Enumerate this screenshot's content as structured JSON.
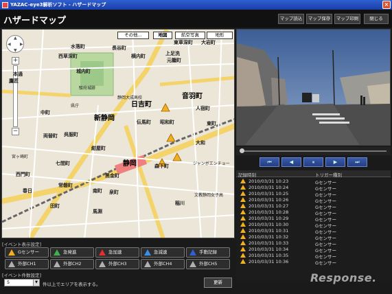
{
  "window": {
    "title": "YAZAC-eye3解析ソフト - ハザードマップ",
    "close": "×"
  },
  "header": {
    "title": "ハザードマップ",
    "buttons": [
      "マップ読込",
      "マップ保存",
      "マップ印刷",
      "閉じる"
    ]
  },
  "map": {
    "types": [
      "その他...",
      "地図",
      "航空写真",
      "地形"
    ],
    "nav": {
      "up": "▲",
      "down": "▼",
      "left": "◀",
      "right": "▶"
    },
    "zoom_in": "+",
    "zoom_out": "−",
    "labels": [
      "東草深町",
      "水落町",
      "西草深町",
      "長谷町",
      "横内町",
      "大岩町",
      "元籠町",
      "城内町",
      "駿府城跡",
      "静岡大成高校",
      "新静岡",
      "日吉町",
      "音羽町",
      "伝馬町",
      "昭和町",
      "人宿町",
      "両替町",
      "紺屋町",
      "静岡",
      "黒金町",
      "南町",
      "森下町",
      "泉町",
      "稲川",
      "馬淵",
      "常磐町",
      "田町",
      "上足洗",
      "本通",
      "鷹匠",
      "大和",
      "東町",
      "中町",
      "呉服町",
      "七間町",
      "春日",
      "宮ヶ崎町",
      "西門町",
      "県庁",
      "文教静岡女子高",
      "ジャンボエンチョー"
    ]
  },
  "video": {},
  "player": {
    "buttons": [
      "⏮",
      "◀",
      "⏸",
      "▶",
      "⏭"
    ]
  },
  "log": {
    "col_time": "記録時刻",
    "col_type": "トリガー種別",
    "rows": [
      {
        "time": "2010/03/31 10:23",
        "type": "Gセンサー"
      },
      {
        "time": "2010/03/31 10:24",
        "type": "Gセンサー"
      },
      {
        "time": "2010/03/31 10:25",
        "type": "Gセンサー"
      },
      {
        "time": "2010/03/31 10:26",
        "type": "Gセンサー"
      },
      {
        "time": "2010/03/31 10:27",
        "type": "Gセンサー"
      },
      {
        "time": "2010/03/31 10:28",
        "type": "Gセンサー"
      },
      {
        "time": "2010/03/31 10:29",
        "type": "Gセンサー"
      },
      {
        "time": "2010/03/31 10:30",
        "type": "Gセンサー"
      },
      {
        "time": "2010/03/31 10:31",
        "type": "Gセンサー"
      },
      {
        "time": "2010/03/31 10:32",
        "type": "Gセンサー"
      },
      {
        "time": "2010/03/31 10:33",
        "type": "Gセンサー"
      },
      {
        "time": "2010/03/31 10:34",
        "type": "Gセンサー"
      },
      {
        "time": "2010/03/31 10:35",
        "type": "Gセンサー"
      },
      {
        "time": "2010/03/31 10:36",
        "type": "Gセンサー"
      }
    ]
  },
  "events": {
    "title": "[イベント表示設定]",
    "buttons": [
      {
        "label": "Gセンサー",
        "color": "#f0b020"
      },
      {
        "label": "急発進",
        "color": "#3fb04a"
      },
      {
        "label": "急加速",
        "color": "#e03030"
      },
      {
        "label": "急減速",
        "color": "#3a8ee8"
      },
      {
        "label": "手動記録",
        "color": "#3060d8"
      },
      {
        "label": "外部CH1",
        "color": "#b0b0b0"
      },
      {
        "label": "外部CH2",
        "color": "#b0b0b0"
      },
      {
        "label": "外部CH3",
        "color": "#b0b0b0"
      },
      {
        "label": "外部CH4",
        "color": "#b0b0b0"
      },
      {
        "label": "外部CH5",
        "color": "#b0b0b0"
      }
    ]
  },
  "filter": {
    "title": "[イベント件数設定]",
    "count": "5",
    "note": "件以上でエリアを表示する。",
    "update": "更新"
  },
  "watermark": "Response."
}
